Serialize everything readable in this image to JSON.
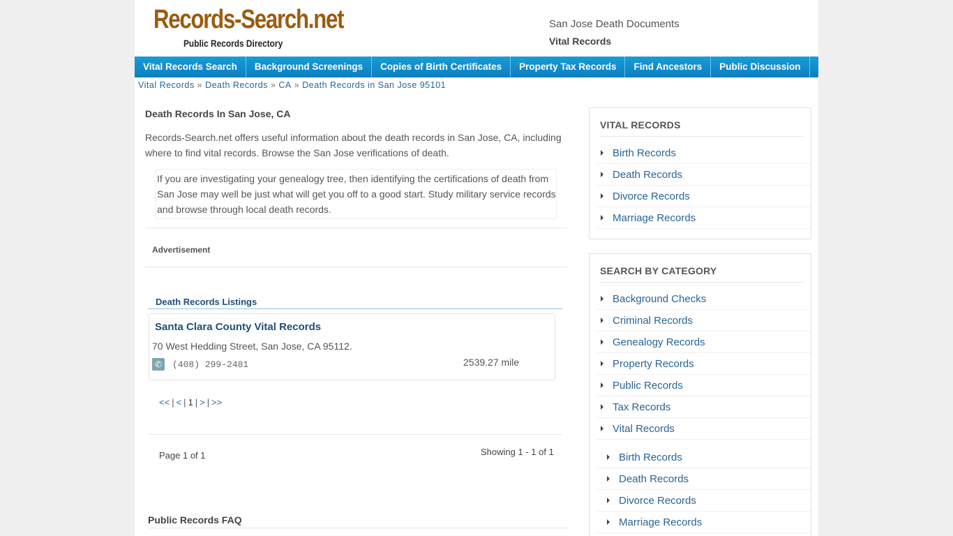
{
  "header": {
    "logo_main": "Records-Search.net",
    "logo_sub": "Public Records Directory",
    "title": "San Jose Death Documents",
    "subtitle": "Vital Records"
  },
  "nav": [
    "Vital Records Search",
    "Background Screenings",
    "Copies of Birth Certificates",
    "Property Tax Records",
    "Find Ancestors",
    "Public Discussion"
  ],
  "breadcrumb": [
    "Vital Records",
    "Death Records",
    "CA",
    "Death Records in San Jose 95101"
  ],
  "breadcrumb_sep": "»",
  "main": {
    "title": "Death Records In San Jose, CA",
    "intro": "Records-Search.net offers useful information about the death records in San Jose, CA, including where to find vital records. Browse the San Jose verifications of death.",
    "quote": "If you are investigating your genealogy tree, then identifying the certifications of death from San Jose may well be just what will get you off to a good start. Study military service records and browse through local death records.",
    "ad_label": "Advertisement",
    "listings_title": "Death Records Listings",
    "listing": {
      "name": "Santa Clara County Vital Records",
      "address": "70 West Hedding Street, San Jose, CA 95112.",
      "phone": "(408) 299-2481",
      "distance": "2539.27 mile"
    },
    "pager": {
      "first": "<<",
      "prev": "<",
      "current": "1",
      "next": ">",
      "last": ">>",
      "bar": "|"
    },
    "page_of": "Page 1 of 1",
    "showing": "Showing 1 - 1 of 1",
    "faq_title": "Public Records FAQ"
  },
  "sidebar": {
    "vital_title": "VITAL RECORDS",
    "vital_items": [
      "Birth Records",
      "Death Records",
      "Divorce Records",
      "Marriage Records"
    ],
    "category_title": "SEARCH BY CATEGORY",
    "category_items": [
      "Background Checks",
      "Criminal Records",
      "Genealogy Records",
      "Property Records",
      "Public Records",
      "Tax Records",
      "Vital Records"
    ],
    "category_sub_items": [
      "Birth Records",
      "Death Records",
      "Divorce Records",
      "Marriage Records"
    ]
  },
  "icons": {
    "phone": "phone-icon",
    "arrow": "caret-right-icon"
  },
  "colors": {
    "nav_bg": "#0a7fc0",
    "link": "#2a6496",
    "heading_blue": "#1f4e79",
    "logo_brown": "#9a5c10"
  }
}
